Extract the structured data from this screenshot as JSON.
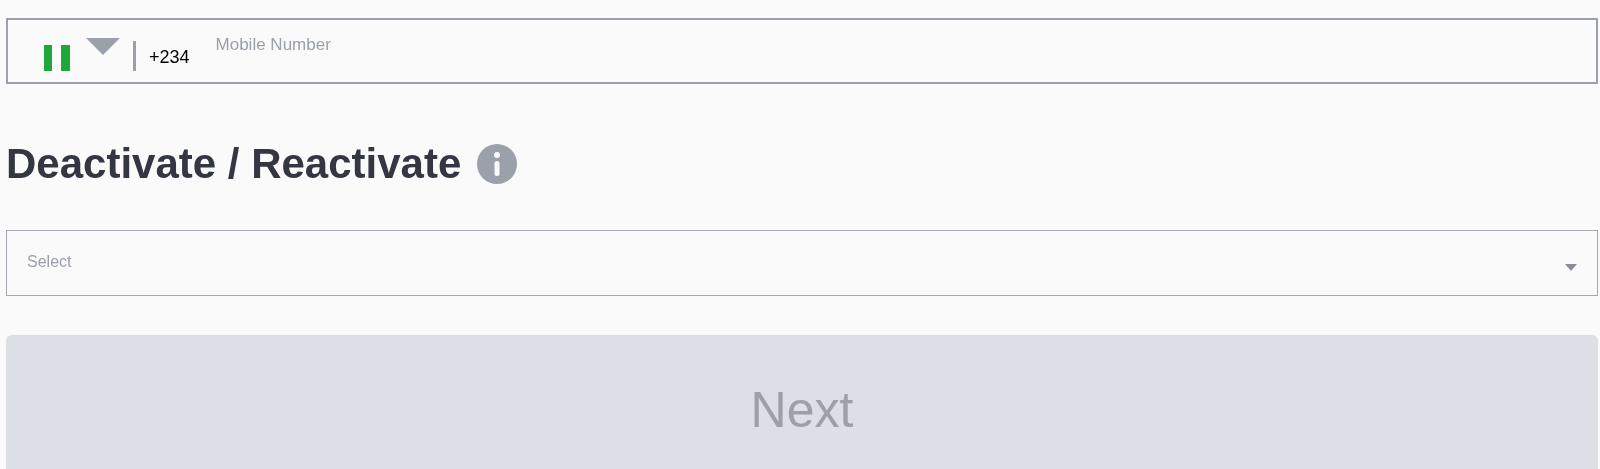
{
  "phone_field": {
    "dial_code": "+234",
    "placeholder": "Mobile Number"
  },
  "heading": "Deactivate / Reactivate",
  "select": {
    "placeholder": "Select"
  },
  "next_button": {
    "label": "Next",
    "disabled": true
  }
}
